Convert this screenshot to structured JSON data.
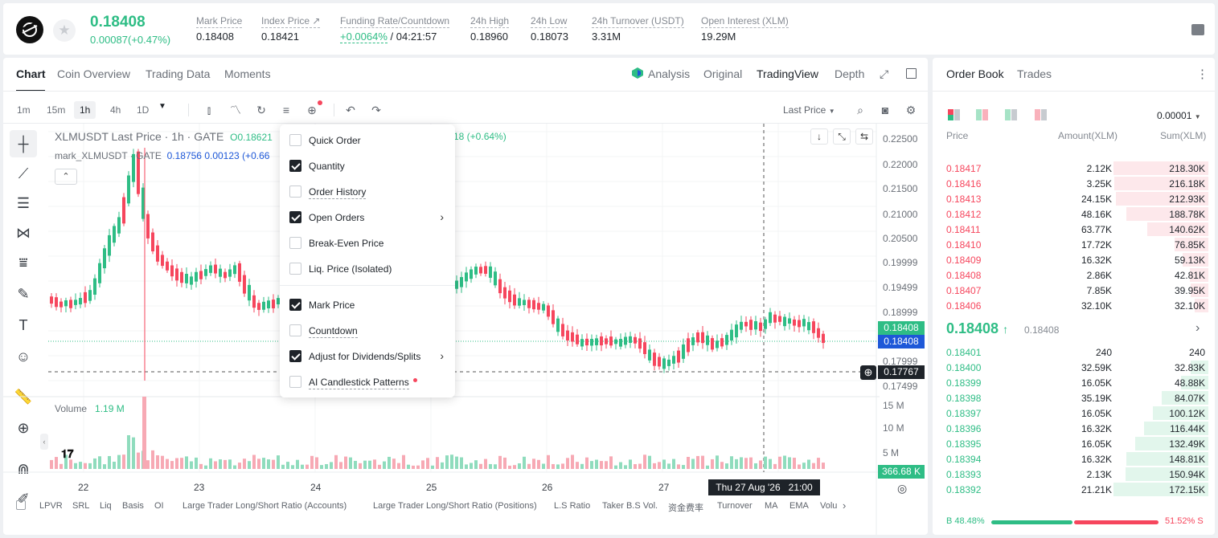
{
  "colors": {
    "up": "#2ebd85",
    "down": "#f6465d",
    "accent_blue": "#1e58d8"
  },
  "header": {
    "last_price": "0.18408",
    "change": "0.00087(+0.47%)",
    "stats": [
      {
        "label": "Mark Price",
        "value": "0.18408"
      },
      {
        "label": "Index Price ↗",
        "value": "0.18421"
      },
      {
        "label": "Funding Rate/Countdown",
        "value_rate": "+0.0064%",
        "value_countdown": " / 04:21:57"
      },
      {
        "label": "24h High",
        "value": "0.18960"
      },
      {
        "label": "24h Low",
        "value": "0.18073"
      },
      {
        "label": "24h Turnover (USDT)",
        "value": "3.31M"
      },
      {
        "label": "Open Interest (XLM)",
        "value": "19.29M"
      }
    ]
  },
  "chart_tabs": [
    "Chart",
    "Coin Overview",
    "Trading Data",
    "Moments"
  ],
  "view_tabs": {
    "analysis": "Analysis",
    "original": "Original",
    "tradingview": "TradingView",
    "depth": "Depth"
  },
  "timeframes": [
    "1m",
    "15m",
    "1h",
    "4h",
    "1D"
  ],
  "price_type": "Last Price",
  "legend": {
    "main": "XLMUSDT Last Price · 1h · GATE",
    "open": "O0.18621",
    "mark": "mark_XLMUSDT · GATE",
    "mark_v1": "0.18756",
    "mark_v2": "0.00123",
    "mark_v3": "(+0.66",
    "chg": "18 (+0.64%)"
  },
  "y_axis": [
    "0.22500",
    "0.22000",
    "0.21500",
    "0.21000",
    "0.20500",
    "0.19999",
    "0.19499",
    "0.18999",
    "0.17999",
    "0.17499"
  ],
  "price_tags": {
    "last": "0.18408",
    "mark": "0.18408",
    "cross": "0.17767",
    "volume": "366.68 K"
  },
  "volume": {
    "label": "Volume",
    "value": "1.19 M",
    "axis": [
      "15 M",
      "10 M",
      "5 M"
    ]
  },
  "x_axis": [
    "22",
    "23",
    "24",
    "25",
    "26",
    "27"
  ],
  "crosshair_time": "Thu 27 Aug '26   21:00",
  "indicators": [
    "LPVR",
    "SRL",
    "Liq",
    "Basis",
    "OI",
    "Large Trader Long/Short Ratio (Accounts)",
    "Large Trader Long/Short Ratio (Positions)",
    "L.S Ratio",
    "Taker B.S Vol.",
    "资金费率",
    "Turnover",
    "MA",
    "EMA",
    "Volu"
  ],
  "dropdown": [
    {
      "label": "Quick Order",
      "checked": false
    },
    {
      "label": "Quantity",
      "checked": true
    },
    {
      "label": "Order History",
      "checked": false
    },
    {
      "label": "Open Orders",
      "checked": true
    },
    {
      "label": "Break-Even Price",
      "checked": false
    },
    {
      "label": "Liq. Price (Isolated)",
      "checked": false
    },
    {
      "label": "Mark Price",
      "checked": true
    },
    {
      "label": "Countdown",
      "checked": false
    },
    {
      "label": "Adjust for Dividends/Splits",
      "checked": true
    },
    {
      "label": "AI Candlestick Patterns",
      "checked": false
    }
  ],
  "orderbook": {
    "tabs": [
      "Order Book",
      "Trades"
    ],
    "precision": "0.00001",
    "headers": [
      "Price",
      "Amount(XLM)",
      "Sum(XLM)"
    ],
    "asks": [
      {
        "price": "0.18417",
        "amount": "2.12K",
        "sum": "218.30K",
        "depth": 1.0
      },
      {
        "price": "0.18416",
        "amount": "3.25K",
        "sum": "216.18K",
        "depth": 0.99
      },
      {
        "price": "0.18413",
        "amount": "24.15K",
        "sum": "212.93K",
        "depth": 0.975
      },
      {
        "price": "0.18412",
        "amount": "48.16K",
        "sum": "188.78K",
        "depth": 0.865
      },
      {
        "price": "0.18411",
        "amount": "63.77K",
        "sum": "140.62K",
        "depth": 0.645
      },
      {
        "price": "0.18410",
        "amount": "17.72K",
        "sum": "76.85K",
        "depth": 0.352
      },
      {
        "price": "0.18409",
        "amount": "16.32K",
        "sum": "59.13K",
        "depth": 0.271
      },
      {
        "price": "0.18408",
        "amount": "2.86K",
        "sum": "42.81K",
        "depth": 0.196
      },
      {
        "price": "0.18407",
        "amount": "7.85K",
        "sum": "39.95K",
        "depth": 0.183
      },
      {
        "price": "0.18406",
        "amount": "32.10K",
        "sum": "32.10K",
        "depth": 0.147
      }
    ],
    "mid_price": "0.18408",
    "mid_mark": "0.18408",
    "bids": [
      {
        "price": "0.18401",
        "amount": "240",
        "sum": "240",
        "depth": 0.0
      },
      {
        "price": "0.18400",
        "amount": "32.59K",
        "sum": "32.83K",
        "depth": 0.19
      },
      {
        "price": "0.18399",
        "amount": "16.05K",
        "sum": "48.88K",
        "depth": 0.284
      },
      {
        "price": "0.18398",
        "amount": "35.19K",
        "sum": "84.07K",
        "depth": 0.488
      },
      {
        "price": "0.18397",
        "amount": "16.05K",
        "sum": "100.12K",
        "depth": 0.582
      },
      {
        "price": "0.18396",
        "amount": "16.32K",
        "sum": "116.44K",
        "depth": 0.676
      },
      {
        "price": "0.18395",
        "amount": "16.05K",
        "sum": "132.49K",
        "depth": 0.77
      },
      {
        "price": "0.18394",
        "amount": "16.32K",
        "sum": "148.81K",
        "depth": 0.864
      },
      {
        "price": "0.18393",
        "amount": "2.13K",
        "sum": "150.94K",
        "depth": 0.877
      },
      {
        "price": "0.18392",
        "amount": "21.21K",
        "sum": "172.15K",
        "depth": 1.0
      }
    ],
    "buy_ratio": "B 48.48%",
    "sell_ratio": "51.52% S",
    "buy_fraction": 0.4848
  }
}
